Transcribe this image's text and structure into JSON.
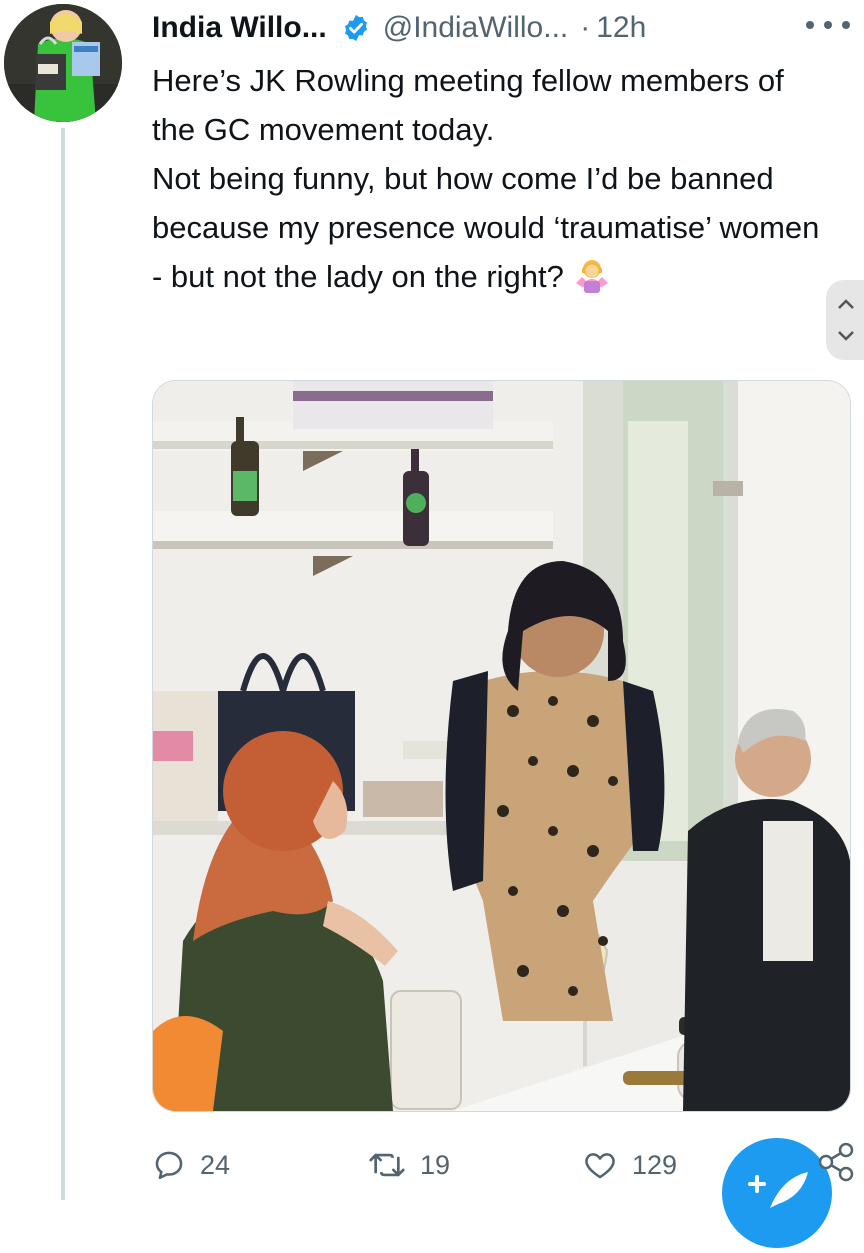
{
  "tweet": {
    "author_name": "India Willo...",
    "handle": "@IndiaWillo...",
    "separator": "·",
    "time": "12h",
    "text_lines": [
      "Here’s JK Rowling meeting fellow members of the GC movement today.",
      "Not being funny, but how come I’d be banned because my presence would ‘traumatise’ women - but not the lady on the right?"
    ]
  },
  "icons": {
    "verified": "verified-badge-icon",
    "more": "more-icon",
    "emoji": "person-shrugging-emoji",
    "reply": "reply-icon",
    "retweet": "retweet-icon",
    "like": "heart-icon",
    "share": "share-icon",
    "compose": "compose-icon"
  },
  "actions": {
    "reply_count": "24",
    "retweet_count": "19",
    "like_count": "129"
  },
  "colors": {
    "text": "#0f1419",
    "secondary": "#536471",
    "accent": "#1d9bf0",
    "border": "#cfd9de"
  }
}
